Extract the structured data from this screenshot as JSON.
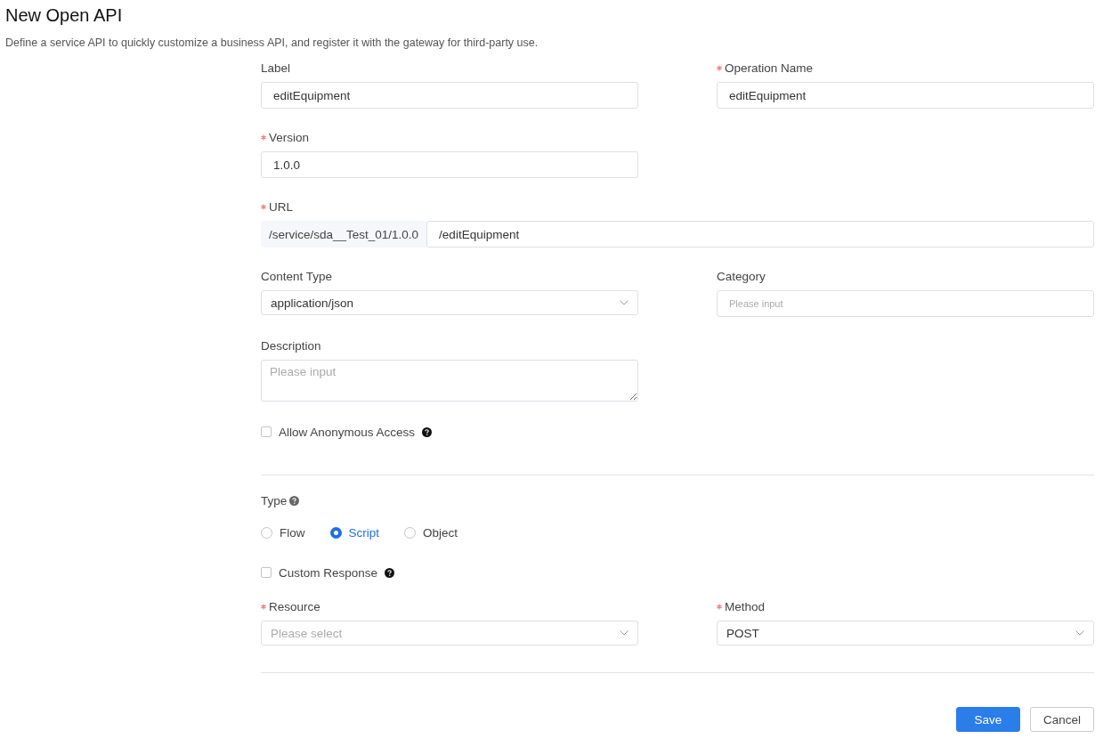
{
  "page": {
    "title": "New Open API",
    "description": "Define a service API to quickly customize a business API, and register it with the gateway for third-party use."
  },
  "form_rows": [
    [
      {
        "kind": "text",
        "label": "Label",
        "required": false,
        "value": "editEquipment"
      },
      {
        "kind": "text",
        "label": "Operation Name",
        "required": true,
        "value": "editEquipment"
      }
    ],
    [
      {
        "kind": "text",
        "label": "Version",
        "required": true,
        "value": "1.0.0"
      }
    ],
    [
      {
        "kind": "url",
        "label": "URL",
        "required": true,
        "prefix": "/service/sda__Test_01/1.0.0",
        "value": "/editEquipment"
      }
    ],
    [
      {
        "kind": "select",
        "label": "Content Type",
        "required": false,
        "value": "application/json"
      },
      {
        "kind": "text",
        "label": "Category",
        "required": false,
        "placeholder": "Please input"
      }
    ],
    [
      {
        "kind": "textarea",
        "label": "Description",
        "required": false,
        "placeholder": "Please input"
      }
    ]
  ],
  "anonymous_access": {
    "label": "Allow Anonymous Access",
    "checked": false
  },
  "type": {
    "label": "Type",
    "options": [
      {
        "label": "Flow",
        "selected": false
      },
      {
        "label": "Script",
        "selected": true
      },
      {
        "label": "Object",
        "selected": false
      }
    ]
  },
  "custom_response": {
    "label": "Custom Response",
    "checked": false
  },
  "binding_rows": [
    [
      {
        "kind": "select",
        "label": "Resource",
        "required": true,
        "placeholder": "Please select"
      },
      {
        "kind": "select",
        "label": "Method",
        "required": true,
        "value": "POST"
      }
    ]
  ],
  "buttons": [
    {
      "label": "Save",
      "kind": "primary"
    },
    {
      "label": "Cancel",
      "kind": "default"
    }
  ]
}
